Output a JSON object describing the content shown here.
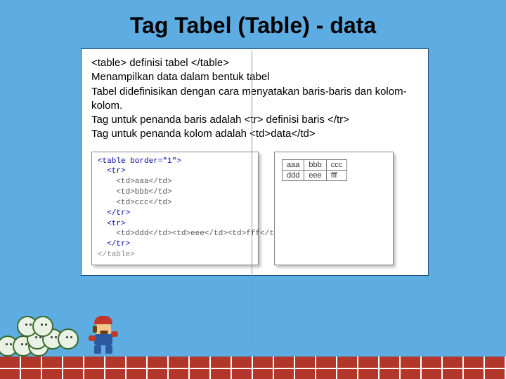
{
  "title": "Tag Tabel (Table) - data",
  "desc": {
    "l1": "<table> definisi tabel </table>",
    "l2": "Menampilkan data dalam bentuk tabel",
    "l3": "Tabel didefinisikan dengan cara menyatakan baris-baris dan kolom-kolom.",
    "l4": "Tag untuk penanda baris adalah <tr> definisi baris </tr>",
    "l5": "Tag untuk penanda kolom adalah <td>data</td>"
  },
  "code": {
    "l01": "<table border=\"1\">",
    "l02": "  <tr>",
    "l03": "    <td>aaa</td>",
    "l04": "    <td>bbb</td>",
    "l05": "    <td>ccc</td>",
    "l06": "  </tr>",
    "l07": "  <tr>",
    "l08": "    <td>ddd</td><td>eee</td><td>fff</td>",
    "l09": "  </tr>",
    "l10": "</table>"
  },
  "output": {
    "rows": [
      [
        "aaa",
        "bbb",
        "ccc"
      ],
      [
        "ddd",
        "eee",
        "fff"
      ]
    ]
  }
}
